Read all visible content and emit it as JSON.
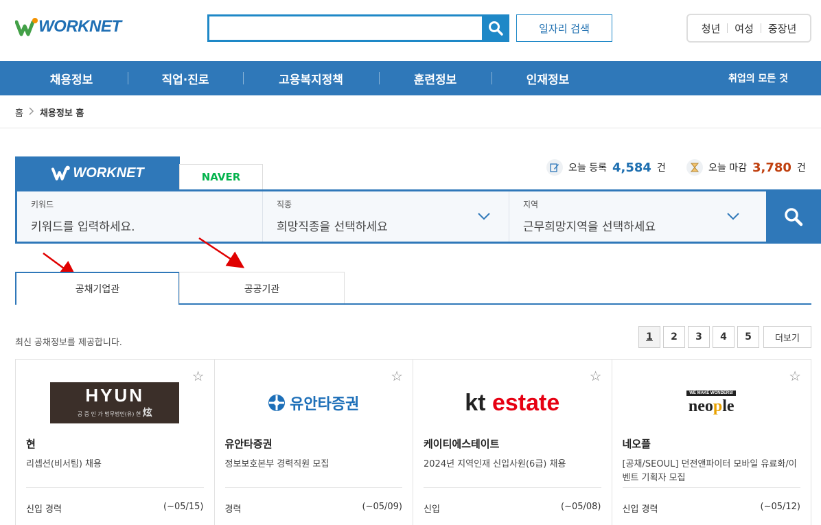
{
  "header": {
    "logo_text": "WORKNET",
    "search_placeholder": "",
    "job_search_label": "일자리 검색",
    "quick_links": [
      "청년",
      "여성",
      "중장년"
    ]
  },
  "nav": {
    "items": [
      "채용정보",
      "직업·진로",
      "고용복지정책",
      "훈련정보",
      "인재정보"
    ],
    "all_label": "취업의 모든 것"
  },
  "breadcrumb": [
    "홈",
    "채용정보 홈"
  ],
  "search_tabs": [
    "WORKNET",
    "NAVER"
  ],
  "stats": {
    "today_reg_label": "오늘 등록",
    "today_reg_value": "4,584",
    "today_reg_unit": "건",
    "today_close_label": "오늘 마감",
    "today_close_value": "3,780",
    "today_close_unit": "건",
    "reg_color": "#1e6fb0",
    "close_color": "#c0400f"
  },
  "search_form": {
    "keyword_label": "키워드",
    "keyword_placeholder": "키워드를 입력하세요.",
    "job_label": "직종",
    "job_placeholder": "희망직종을 선택하세요",
    "region_label": "지역",
    "region_placeholder": "근무희망지역을 선택하세요"
  },
  "content_tabs": [
    "공채기업관",
    "공공기관"
  ],
  "notice": "최신 공채정보를 제공합니다.",
  "pager": {
    "pages": [
      "1",
      "2",
      "3",
      "4",
      "5"
    ],
    "current": "1",
    "more_label": "더보기"
  },
  "cards": [
    {
      "company": "현",
      "title": "리셉션(비서팀) 채용",
      "type": "신입 경력",
      "deadline": "(~05/15)",
      "logo": {
        "main": "HYUN",
        "sub": "공 증 인 가  법무법인(유) 현",
        "mark": "炫"
      }
    },
    {
      "company": "유안타증권",
      "title": "정보보호본부 경력직원 모집",
      "type": "경력",
      "deadline": "(~05/09)",
      "logo": {
        "main": "유안타증권"
      }
    },
    {
      "company": "케이티에스테이트",
      "title": "2024년 지역인재 신입사원(6급) 채용",
      "type": "신입",
      "deadline": "(~05/08)",
      "logo": {
        "main_a": "kt",
        "main_b": " estate"
      }
    },
    {
      "company": "네오플",
      "title": "[공채/SEOUL] 던전앤파이터 모바일 유료화/이벤트 기획자 모집",
      "type": "신입 경력",
      "deadline": "(~05/12)",
      "logo": {
        "tag": "WE MAKE WONDERS!",
        "main_a": "neo",
        "main_b": "p",
        "main_c": "le"
      }
    }
  ],
  "colors": {
    "brand": "#2f78b9",
    "search_accent": "#1e88c7",
    "arrow": "#e00000"
  },
  "icons": [
    "search-icon",
    "chevron-down-icon",
    "star-icon",
    "edit-icon",
    "hourglass-icon",
    "chevron-right-icon"
  ]
}
